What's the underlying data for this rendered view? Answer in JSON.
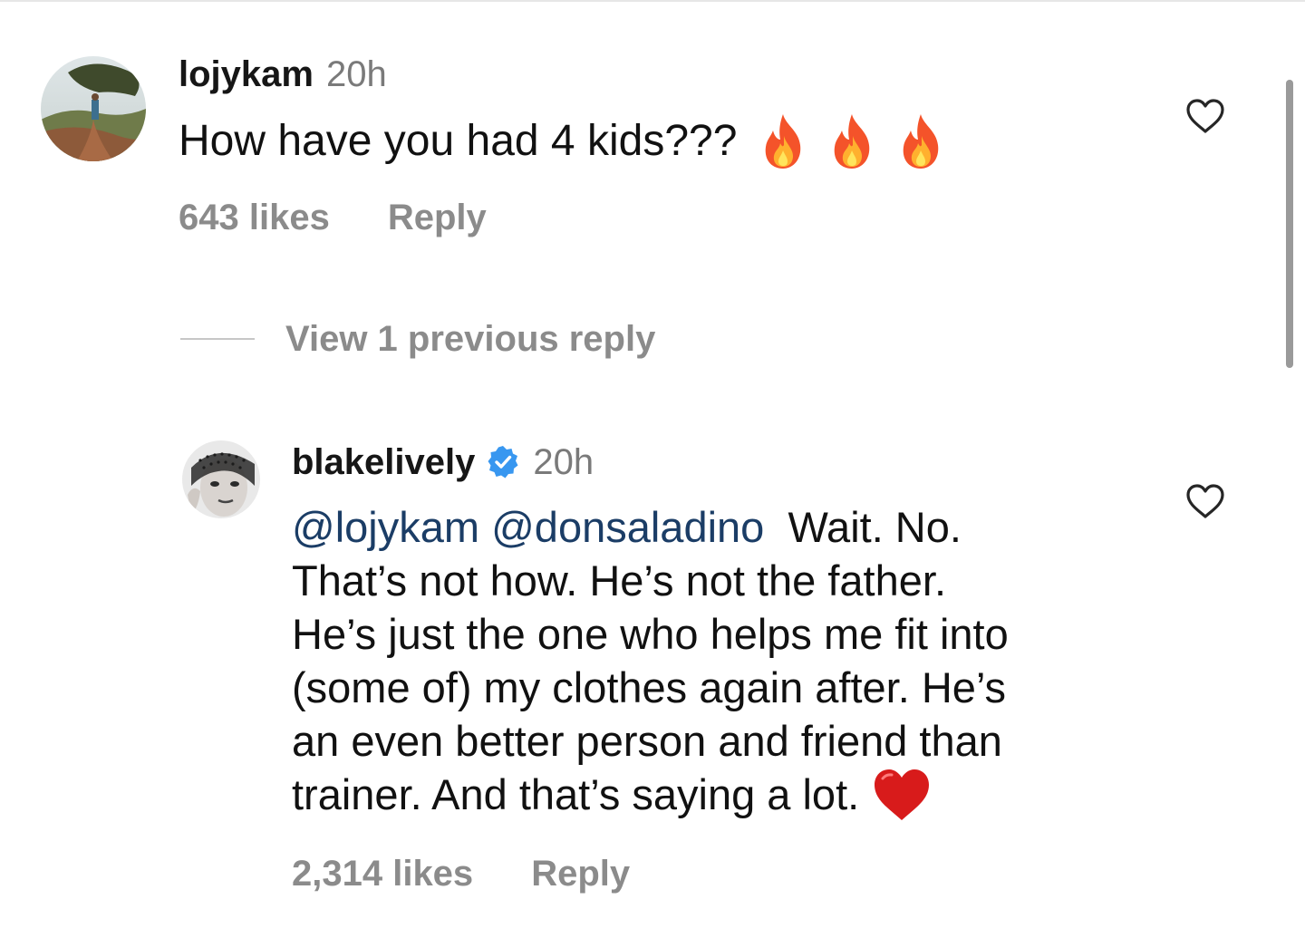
{
  "comments": [
    {
      "username": "lojykam",
      "time": "20h",
      "text": "How have you had 4 kids???",
      "emoji": [
        "fire",
        "fire",
        "fire"
      ],
      "likes": "643 likes",
      "reply_label": "Reply",
      "verified": false
    },
    {
      "username": "blakelively",
      "time": "20h",
      "verified": true,
      "mentions": [
        "@lojykam",
        "@donsaladino"
      ],
      "text_lines": [
        "Wait. No.",
        "That’s not how. He’s not the father.",
        "He’s just the one who helps me fit into",
        "(some of) my clothes again after. He’s",
        "an even better person and friend than",
        "trainer. And that’s saying a lot."
      ],
      "emoji": [
        "red-heart"
      ],
      "likes": "2,314 likes",
      "reply_label": "Reply"
    }
  ],
  "thread": {
    "view_replies_label": "View 1 previous reply"
  },
  "colors": {
    "text": "#111111",
    "muted": "#8b8b8b",
    "mention": "#1b3d66",
    "verified": "#3897f0"
  }
}
